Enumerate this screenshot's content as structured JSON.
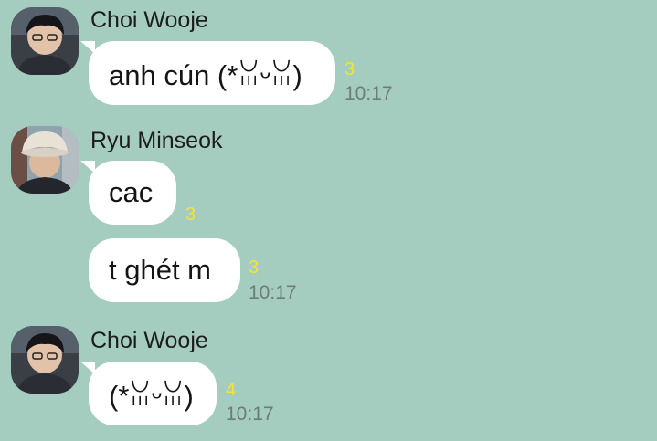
{
  "chat": {
    "groups": [
      {
        "sender": "Choi Wooje",
        "messages": [
          {
            "text": "anh cún (*ꈍᵕꈍ)",
            "unread": "3",
            "time": "10:17"
          }
        ]
      },
      {
        "sender": "Ryu Minseok",
        "messages": [
          {
            "text": "cac",
            "unread": "3",
            "time": ""
          },
          {
            "text": "t ghét m",
            "unread": "3",
            "time": "10:17"
          }
        ]
      },
      {
        "sender": "Choi Wooje",
        "messages": [
          {
            "text": "(*ꈍᵕꈍ)",
            "unread": "4",
            "time": "10:17"
          }
        ]
      }
    ]
  },
  "colors": {
    "background": "#a5cdbf",
    "bubble": "#ffffff",
    "unread": "#f2e23a",
    "time": "#6c7d77"
  }
}
